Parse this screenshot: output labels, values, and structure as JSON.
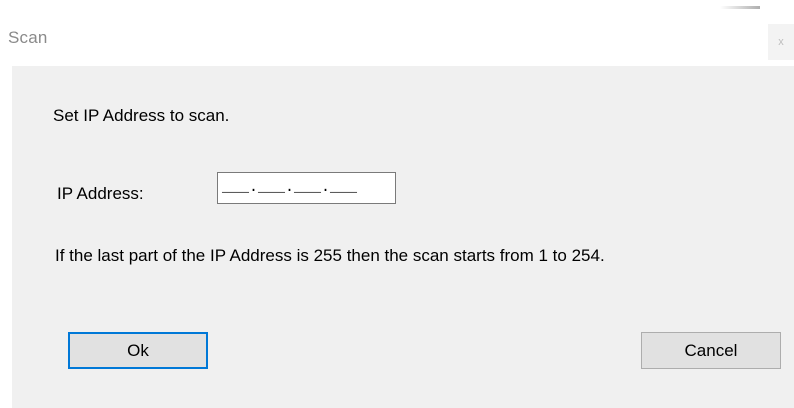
{
  "window": {
    "title": "Scan",
    "close_glyph": "x"
  },
  "dialog": {
    "instruction": "Set IP Address to scan.",
    "ip_label": "IP Address:",
    "ip_value": "___.___.___.___",
    "hint": "If the last part of the IP Address is 255 then the scan starts from 1 to 254."
  },
  "buttons": {
    "ok_label": "Ok",
    "cancel_label": "Cancel"
  },
  "colors": {
    "panel_bg": "#f0f0f0",
    "focus_border": "#0078d7",
    "button_bg": "#e1e1e1"
  }
}
